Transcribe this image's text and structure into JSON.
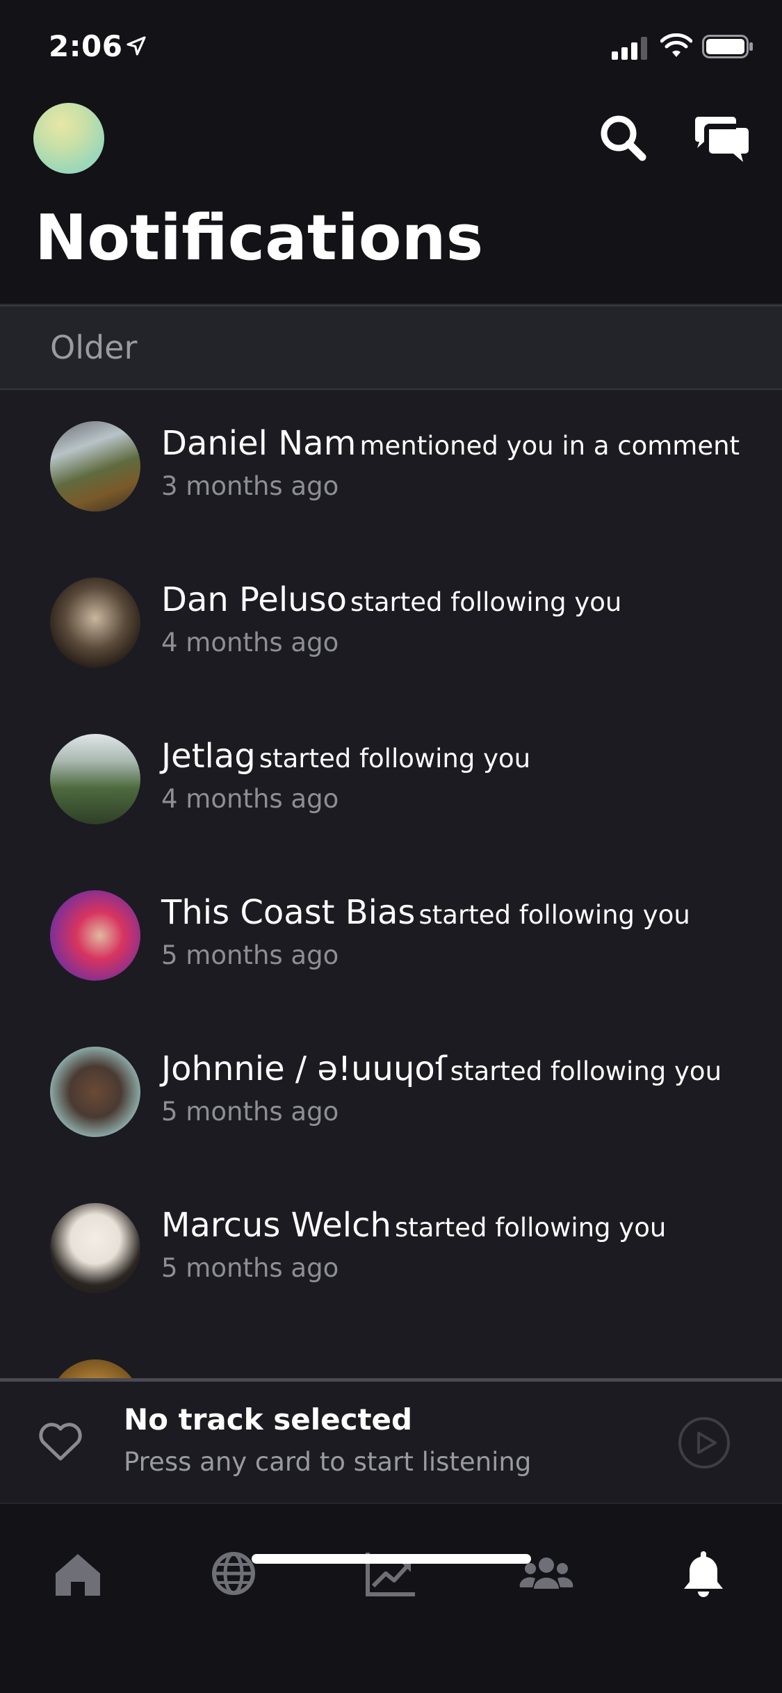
{
  "status_bar": {
    "time": "2:06"
  },
  "header": {
    "title": "Notifications"
  },
  "section": {
    "label": "Older"
  },
  "notifications": [
    {
      "name": "Daniel Nam",
      "action": "mentioned you in a comment",
      "time": "3 months ago"
    },
    {
      "name": "Dan Peluso",
      "action": "started following you",
      "time": "4 months ago"
    },
    {
      "name": "Jetlag",
      "action": "started following you",
      "time": "4 months ago"
    },
    {
      "name": "This Coast Bias",
      "action": "started following you",
      "time": "5 months ago"
    },
    {
      "name": "Johnnie / ǝ!uuɥoſ",
      "action": "started following you",
      "time": "5 months ago"
    },
    {
      "name": "Marcus Welch",
      "action": "started following you",
      "time": "5 months ago"
    }
  ],
  "player": {
    "title": "No track selected",
    "subtitle": "Press any card to start listening"
  },
  "tabs": [
    {
      "icon": "home-icon",
      "active": false
    },
    {
      "icon": "globe-icon",
      "active": false
    },
    {
      "icon": "trending-icon",
      "active": false
    },
    {
      "icon": "users-icon",
      "active": false
    },
    {
      "icon": "bell-icon",
      "active": true
    }
  ],
  "colors": {
    "background": "#1b1b21",
    "header_background": "#121217",
    "muted_text": "#8e8e96",
    "inactive_icon": "#6f6f77",
    "active_icon": "#ffffff"
  }
}
